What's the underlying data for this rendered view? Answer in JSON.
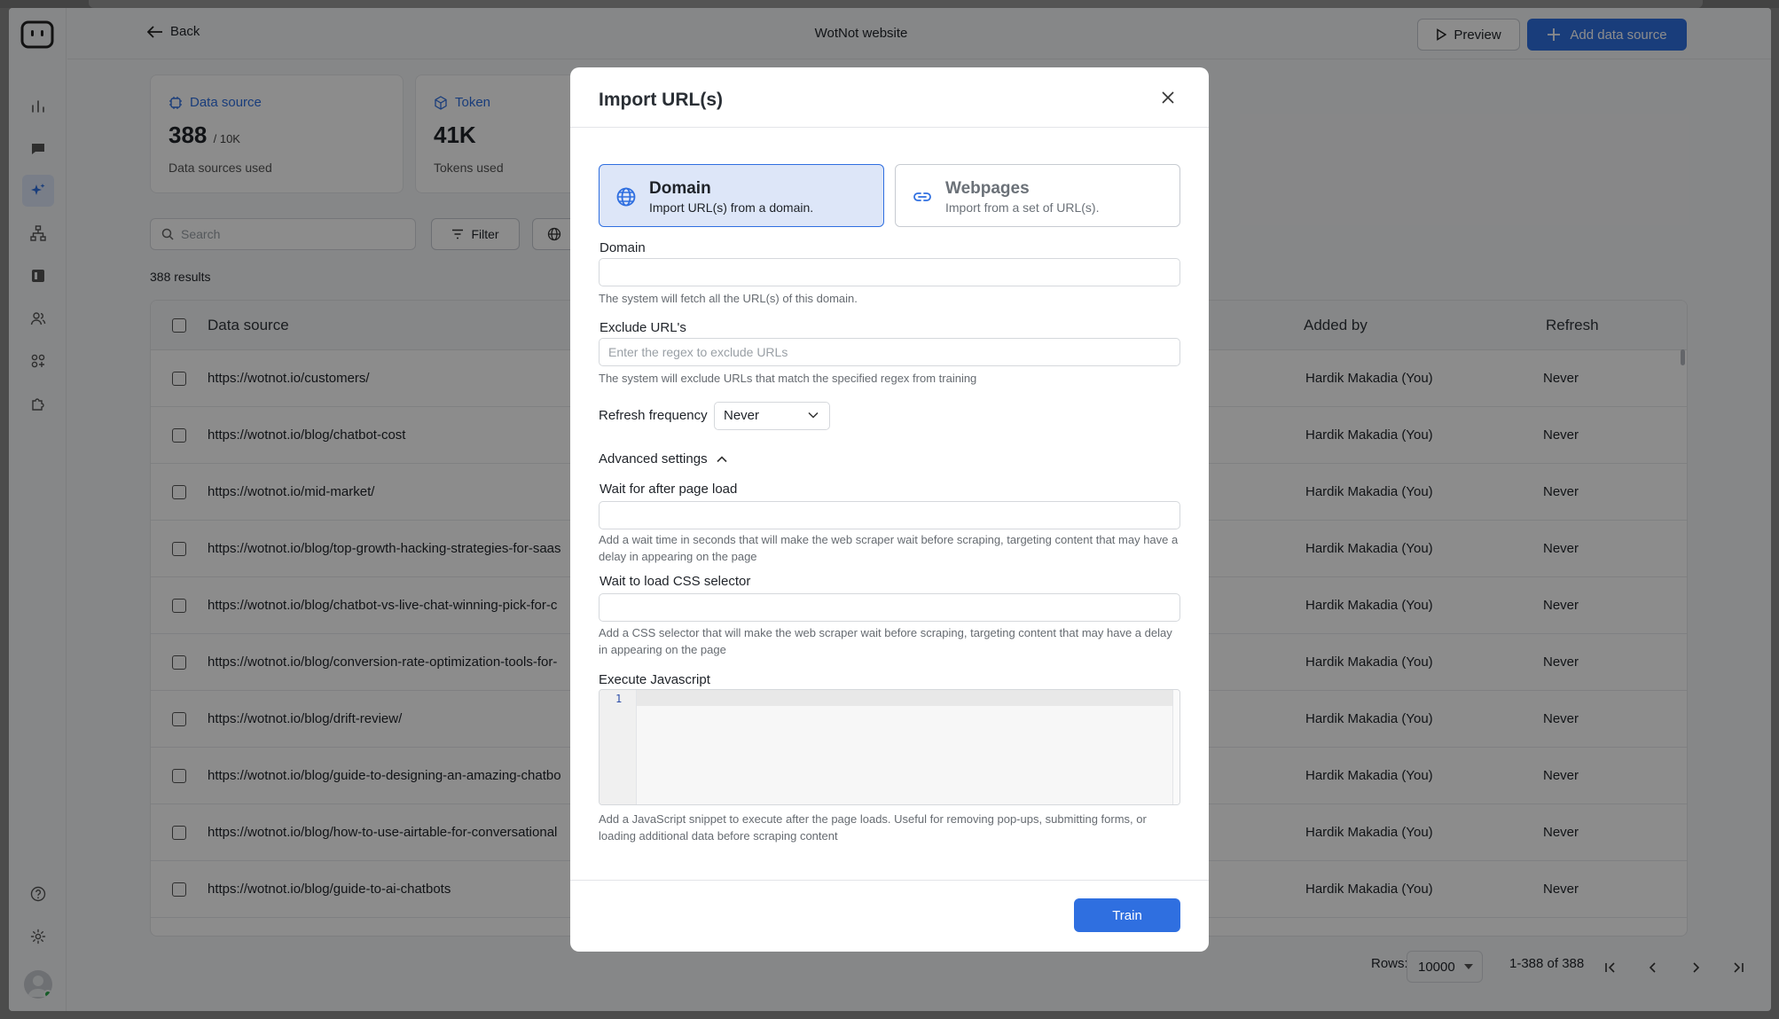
{
  "header": {
    "back_label": "Back",
    "title": "WotNot website",
    "preview_label": "Preview",
    "add_source_label": "Add data source"
  },
  "stats": {
    "data_source": {
      "label": "Data source",
      "value": "388",
      "limit": "/ 10K",
      "sub": "Data sources used"
    },
    "token": {
      "label": "Token",
      "value": "41K",
      "sub": "Tokens used"
    }
  },
  "toolbar": {
    "search_placeholder": "Search",
    "filter_label": "Filter",
    "results": "388 results"
  },
  "table": {
    "headers": {
      "data_source": "Data source",
      "added_by": "Added by",
      "refresh": "Refresh"
    },
    "rows": [
      {
        "url": "https://wotnot.io/customers/",
        "added_by": "Hardik Makadia (You)",
        "refresh": "Never"
      },
      {
        "url": "https://wotnot.io/blog/chatbot-cost",
        "added_by": "Hardik Makadia (You)",
        "refresh": "Never"
      },
      {
        "url": "https://wotnot.io/mid-market/",
        "added_by": "Hardik Makadia (You)",
        "refresh": "Never"
      },
      {
        "url": "https://wotnot.io/blog/top-growth-hacking-strategies-for-saas",
        "added_by": "Hardik Makadia (You)",
        "refresh": "Never"
      },
      {
        "url": "https://wotnot.io/blog/chatbot-vs-live-chat-winning-pick-for-c",
        "added_by": "Hardik Makadia (You)",
        "refresh": "Never"
      },
      {
        "url": "https://wotnot.io/blog/conversion-rate-optimization-tools-for-",
        "added_by": "Hardik Makadia (You)",
        "refresh": "Never"
      },
      {
        "url": "https://wotnot.io/blog/drift-review/",
        "added_by": "Hardik Makadia (You)",
        "refresh": "Never"
      },
      {
        "url": "https://wotnot.io/blog/guide-to-designing-an-amazing-chatbo",
        "added_by": "Hardik Makadia (You)",
        "refresh": "Never"
      },
      {
        "url": "https://wotnot.io/blog/how-to-use-airtable-for-conversational",
        "added_by": "Hardik Makadia (You)",
        "refresh": "Never"
      },
      {
        "url": "https://wotnot.io/blog/guide-to-ai-chatbots",
        "added_by": "Hardik Makadia (You)",
        "refresh": "Never"
      }
    ]
  },
  "pagination": {
    "rows_label": "Rows:",
    "rows_value": "10000",
    "range": "1-388 of 388"
  },
  "modal": {
    "title": "Import URL(s)",
    "options": {
      "domain": {
        "title": "Domain",
        "desc": "Import URL(s) from a domain."
      },
      "webpages": {
        "title": "Webpages",
        "desc": "Import from a set of URL(s)."
      }
    },
    "domain_label": "Domain",
    "domain_value": "",
    "domain_help": "The system will fetch all the URL(s) of this domain.",
    "exclude_label": "Exclude URL's",
    "exclude_placeholder": "Enter the regex to exclude URLs",
    "exclude_help": "The system will exclude URLs that match the specified regex from training",
    "refresh_label": "Refresh frequency",
    "refresh_value": "Never",
    "advanced_label": "Advanced settings",
    "wait_label": "Wait for after page load",
    "wait_help": "Add a wait time in seconds that will make the web scraper wait before scraping, targeting content that may have a delay in appearing on the page",
    "css_label": "Wait to load CSS selector",
    "css_help": "Add a CSS selector that will make the web scraper wait before scraping, targeting content that may have a delay in appearing on the page",
    "js_label": "Execute Javascript",
    "js_line_number": "1",
    "js_help": "Add a JavaScript snippet to execute after the page loads. Useful for removing pop-ups, submitting forms, or loading additional data before scraping content",
    "train_label": "Train"
  },
  "colors": {
    "accent": "#2f6fe0",
    "selected_bg": "#dde6f8",
    "online": "#2aa84a"
  }
}
